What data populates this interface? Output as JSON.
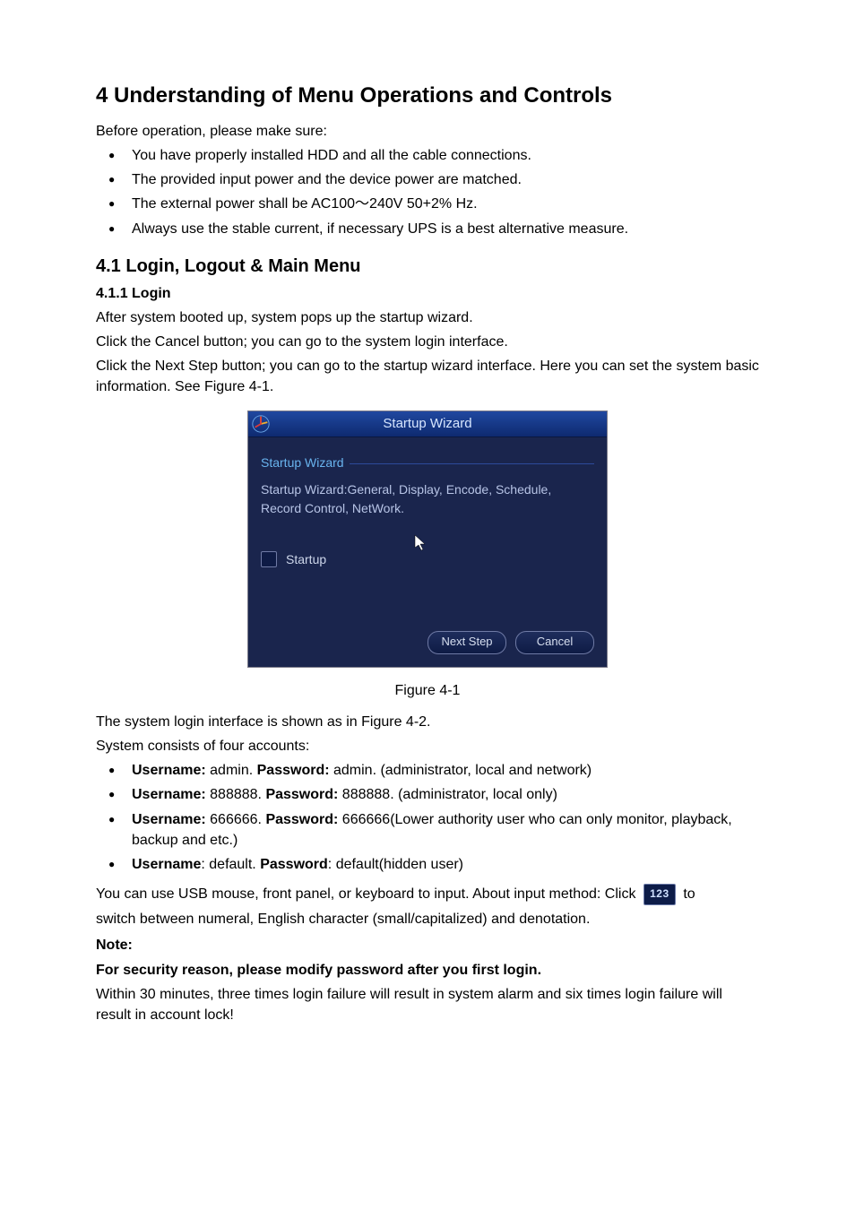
{
  "h1": "4 Understanding of Menu Operations and Controls",
  "p_intro": "Before operation, please make sure:",
  "pre_list": [
    "You have properly installed HDD and all the cable connections.",
    "The provided input power and the device power are matched.",
    "The external power shall be AC100～240V 50+2% Hz.",
    "Always use the stable current, if necessary UPS is a best alternative measure."
  ],
  "h2": "4.1   Login, Logout & Main Menu",
  "h3": "4.1.1  Login",
  "p_after_h3_1": "After system booted up, system pops up the startup wizard.",
  "p_after_h3_2": "Click the Cancel button; you can go to the system login interface.",
  "p_after_h3_3": "Click the Next Step button; you can go to the startup wizard interface. Here you can set the system basic information. See Figure 4-1.",
  "dialog": {
    "title": "Startup Wizard",
    "group_label": "Startup Wizard",
    "desc": "Startup Wizard:General, Display, Encode, Schedule, Record Control, NetWork.",
    "checkbox_label": "Startup",
    "btn_next": "Next Step",
    "btn_cancel": "Cancel"
  },
  "fig1_caption": "Figure 4-1",
  "p_fig1_1": "The system login interface is shown as in Figure 4-2.",
  "p_fig1_2": "System consists of four accounts:",
  "accounts": [
    {
      "u_lbl": "Username:",
      "u_val": " admin.  ",
      "p_lbl": "Password:",
      "p_val": " admin. (administrator, local and network)"
    },
    {
      "u_lbl": "Username:",
      "u_val": " 888888. ",
      "p_lbl": "Password:",
      "p_val": " 888888. (administrator, local only)"
    },
    {
      "u_lbl": "Username:",
      "u_val": " 666666. ",
      "p_lbl": "Password:",
      "p_val": " 666666(Lower authority user who can only monitor, playback, backup and etc.)"
    },
    {
      "u_lbl": "Username",
      "u_val": ": default. ",
      "p_lbl": "Password",
      "p_val": ": default(hidden user)"
    }
  ],
  "p_input_before": "You can use USB mouse, front panel, or keyboard to input. About input method: Click ",
  "p_input_after": " to",
  "p_switch": "switch between numeral, English character (small/capitalized) and denotation.",
  "note_lbl": "Note:",
  "note_bold": "For security reason, please modify password after you first login.",
  "note_body": "Within 30 minutes, three times login failure will result in system alarm and six times login failure will result in account lock!"
}
